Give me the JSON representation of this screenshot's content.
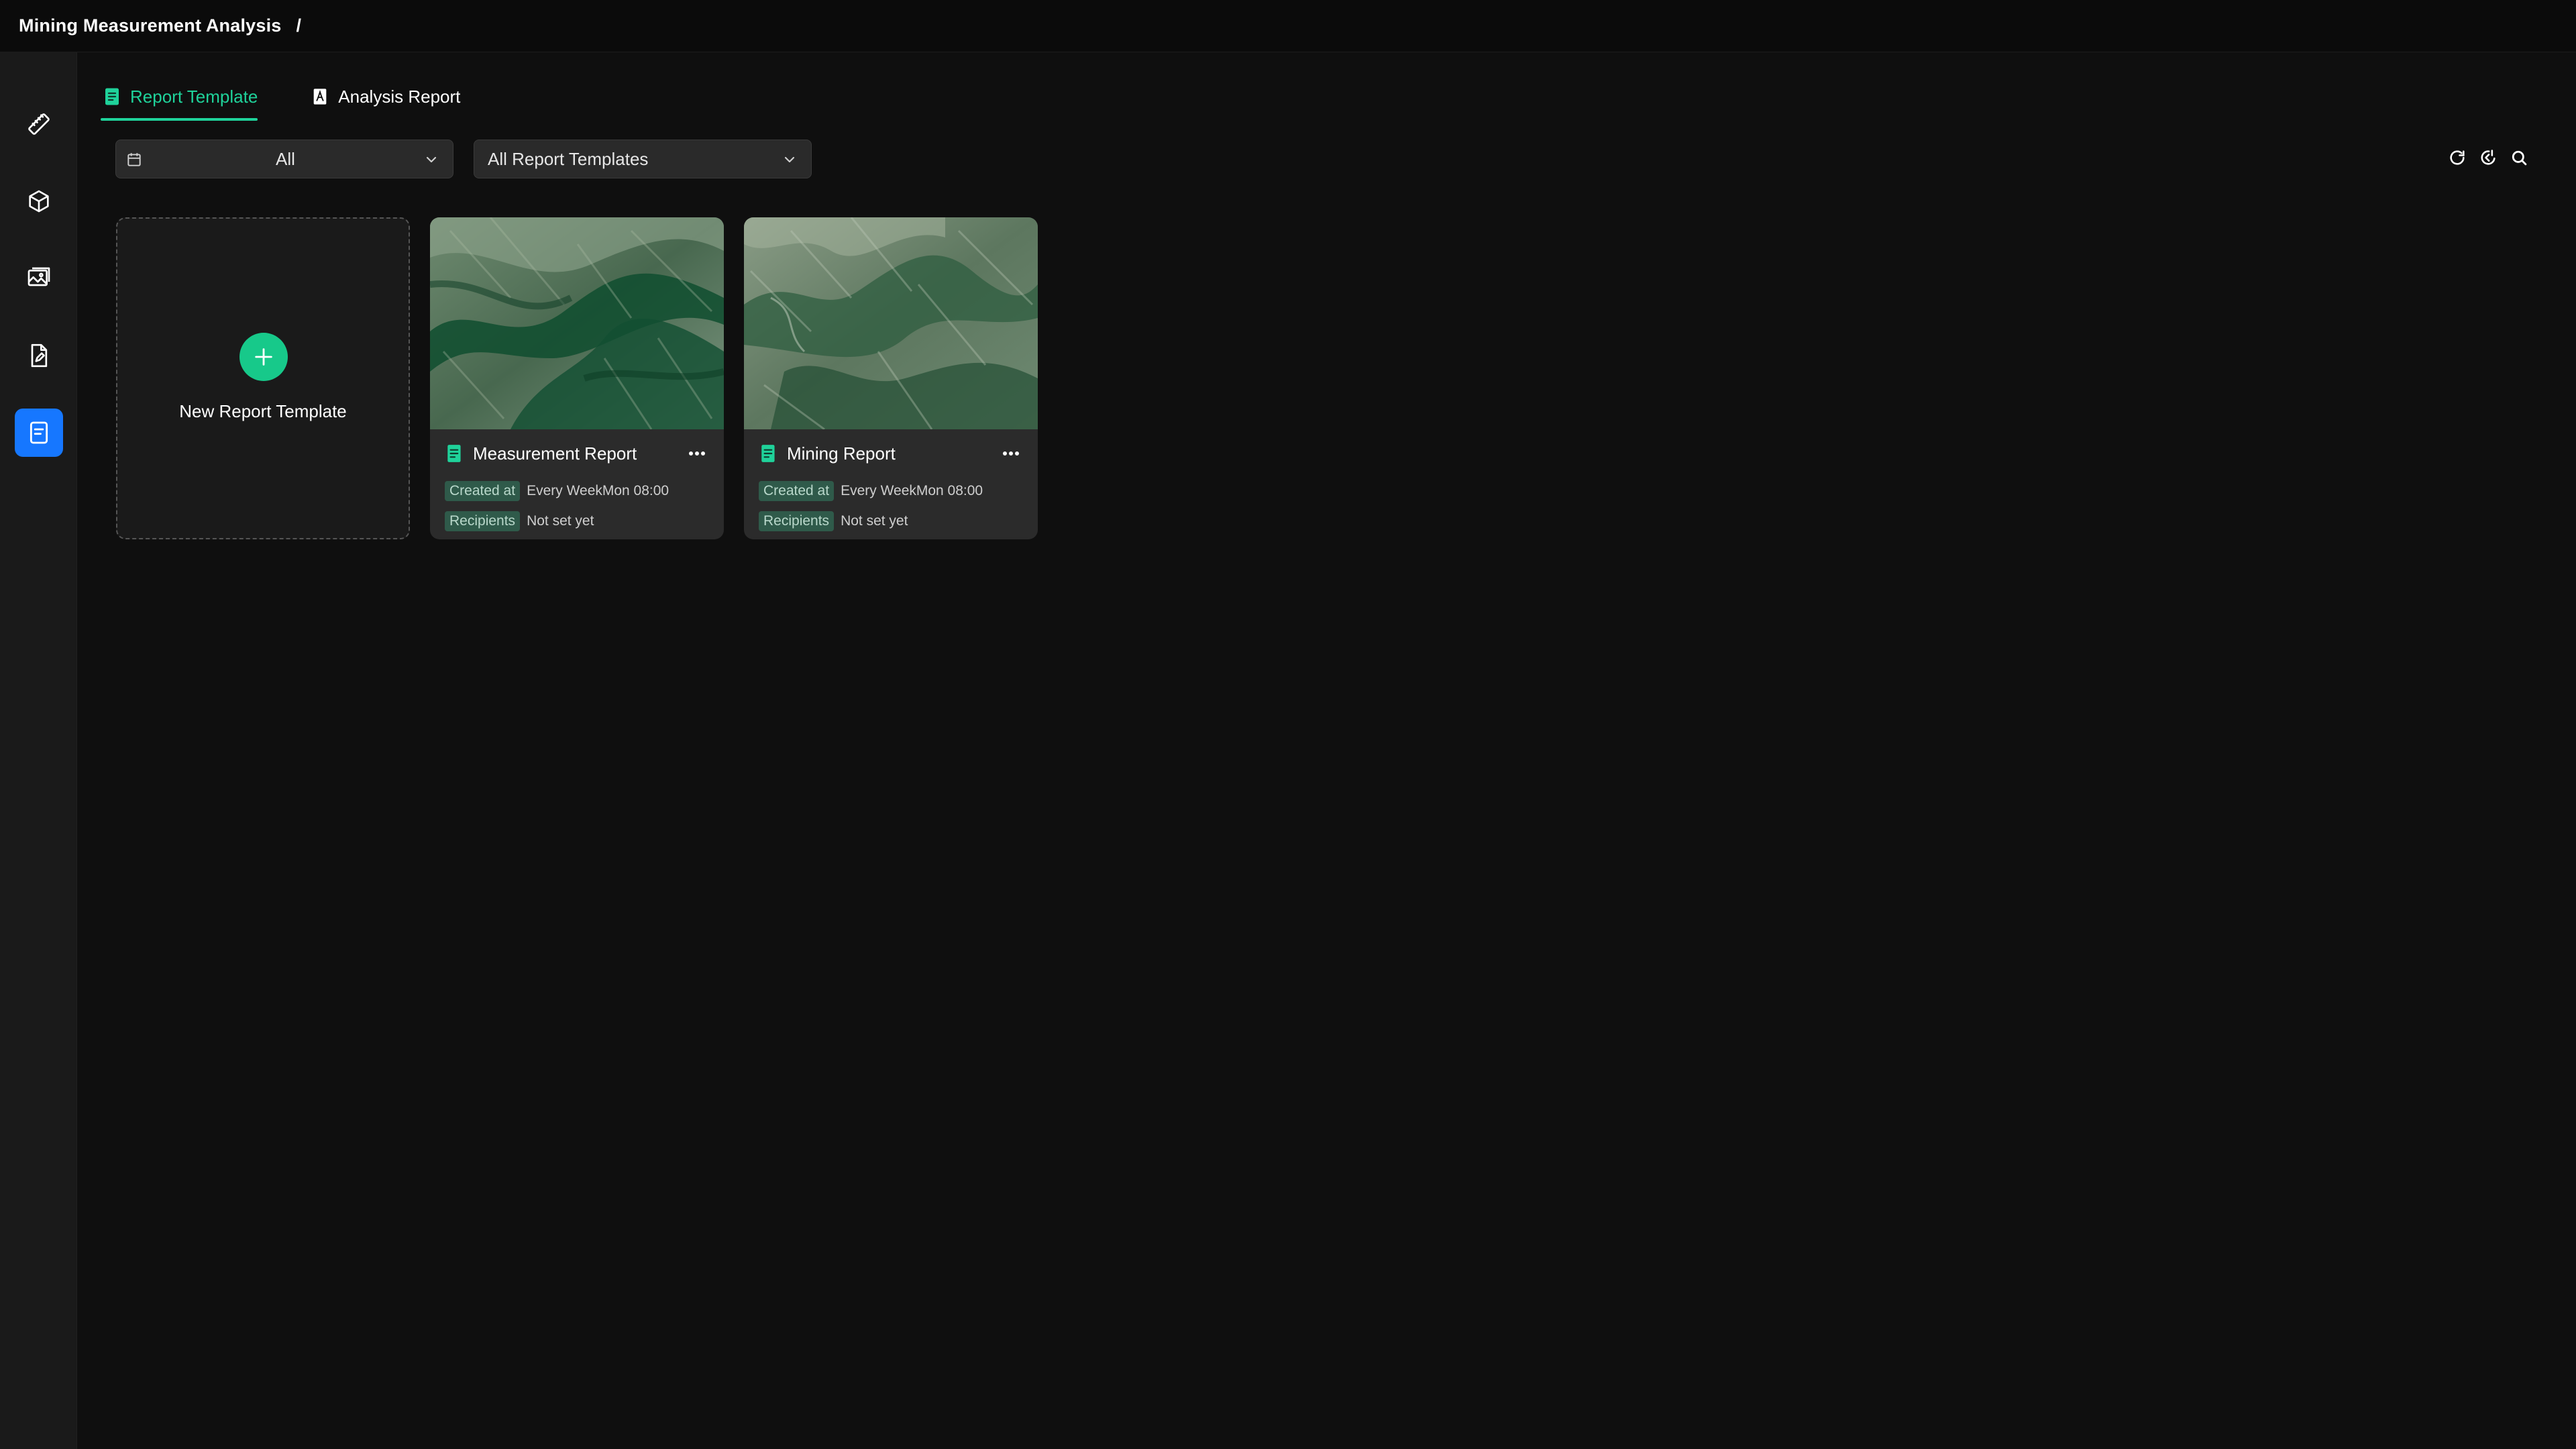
{
  "app": {
    "title": "Mining Measurement Analysis",
    "separator": "/"
  },
  "sidebar": {
    "items": [
      {
        "icon": "ruler-icon"
      },
      {
        "icon": "cube-icon"
      },
      {
        "icon": "gallery-icon"
      },
      {
        "icon": "document-edit-icon"
      },
      {
        "icon": "report-template-icon",
        "active": true
      }
    ]
  },
  "tabs": [
    {
      "label": "Report Template",
      "active": true
    },
    {
      "label": "Analysis Report",
      "active": false
    }
  ],
  "filters": {
    "date": {
      "value": "All"
    },
    "template": {
      "value": "All Report Templates"
    }
  },
  "toolbar": {
    "icons": [
      "refresh-icon",
      "ai-assist-icon",
      "search-icon"
    ]
  },
  "new_card": {
    "label": "New Report Template"
  },
  "cards": [
    {
      "title": "Measurement Report",
      "created_label": "Created at",
      "created_value": "Every WeekMon 08:00",
      "recipients_label": "Recipients",
      "recipients_value": "Not set yet"
    },
    {
      "title": "Mining Report",
      "created_label": "Created at",
      "created_value": "Every WeekMon 08:00",
      "recipients_label": "Recipients",
      "recipients_value": "Not set yet"
    }
  ],
  "colors": {
    "accent": "#1fd29a",
    "primary": "#1677ff",
    "background": "#0f0f0f",
    "sidebar": "#1a1a1a"
  }
}
